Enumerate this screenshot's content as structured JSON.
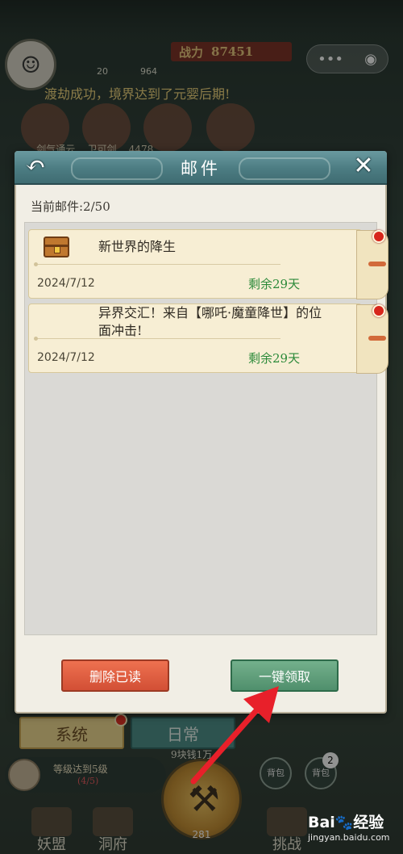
{
  "background": {
    "power_label": "战力",
    "power_value": "87451",
    "res_left": "20",
    "res_right": "964",
    "banner": "渡劫成功，境界达到了元婴后期!",
    "scroll_text": "... 剑气通云  ...卫可剑   ...4478",
    "capsule_more": "•••",
    "capsule_target": "◉"
  },
  "modal": {
    "title": "邮件",
    "count_label": "当前邮件:2/50",
    "mails": [
      {
        "subject": "新世界的降生",
        "date": "2024/7/12",
        "remain": "剩余29天"
      },
      {
        "subject": "异界交汇！来自【哪吒·魔童降世】的位面冲击!",
        "date": "2024/7/12",
        "remain": "剩余29天"
      }
    ],
    "delete_label": "删除已读",
    "claim_label": "一键领取"
  },
  "bottom": {
    "tab_system": "系统",
    "tab_daily": "日常",
    "reward_text": "9块钱1万",
    "task_title": "等级达到5级",
    "task_progress": "(4/5)",
    "ring_count": "281",
    "side_left": "背包",
    "side_right": "背包",
    "side_badge": "2",
    "nav_left": "妖盟",
    "nav_mid": "洞府",
    "nav_right": "挑战"
  },
  "watermark": {
    "logo": "Bai",
    "logo_tail": "经验",
    "site": "jingyan.baidu.com"
  },
  "colors": {
    "header_teal": "#4c7c82",
    "remain_green": "#2c8a3a",
    "delete_red": "#d24f35",
    "claim_green": "#4f8f6c",
    "annotation_red": "#e8202a"
  }
}
